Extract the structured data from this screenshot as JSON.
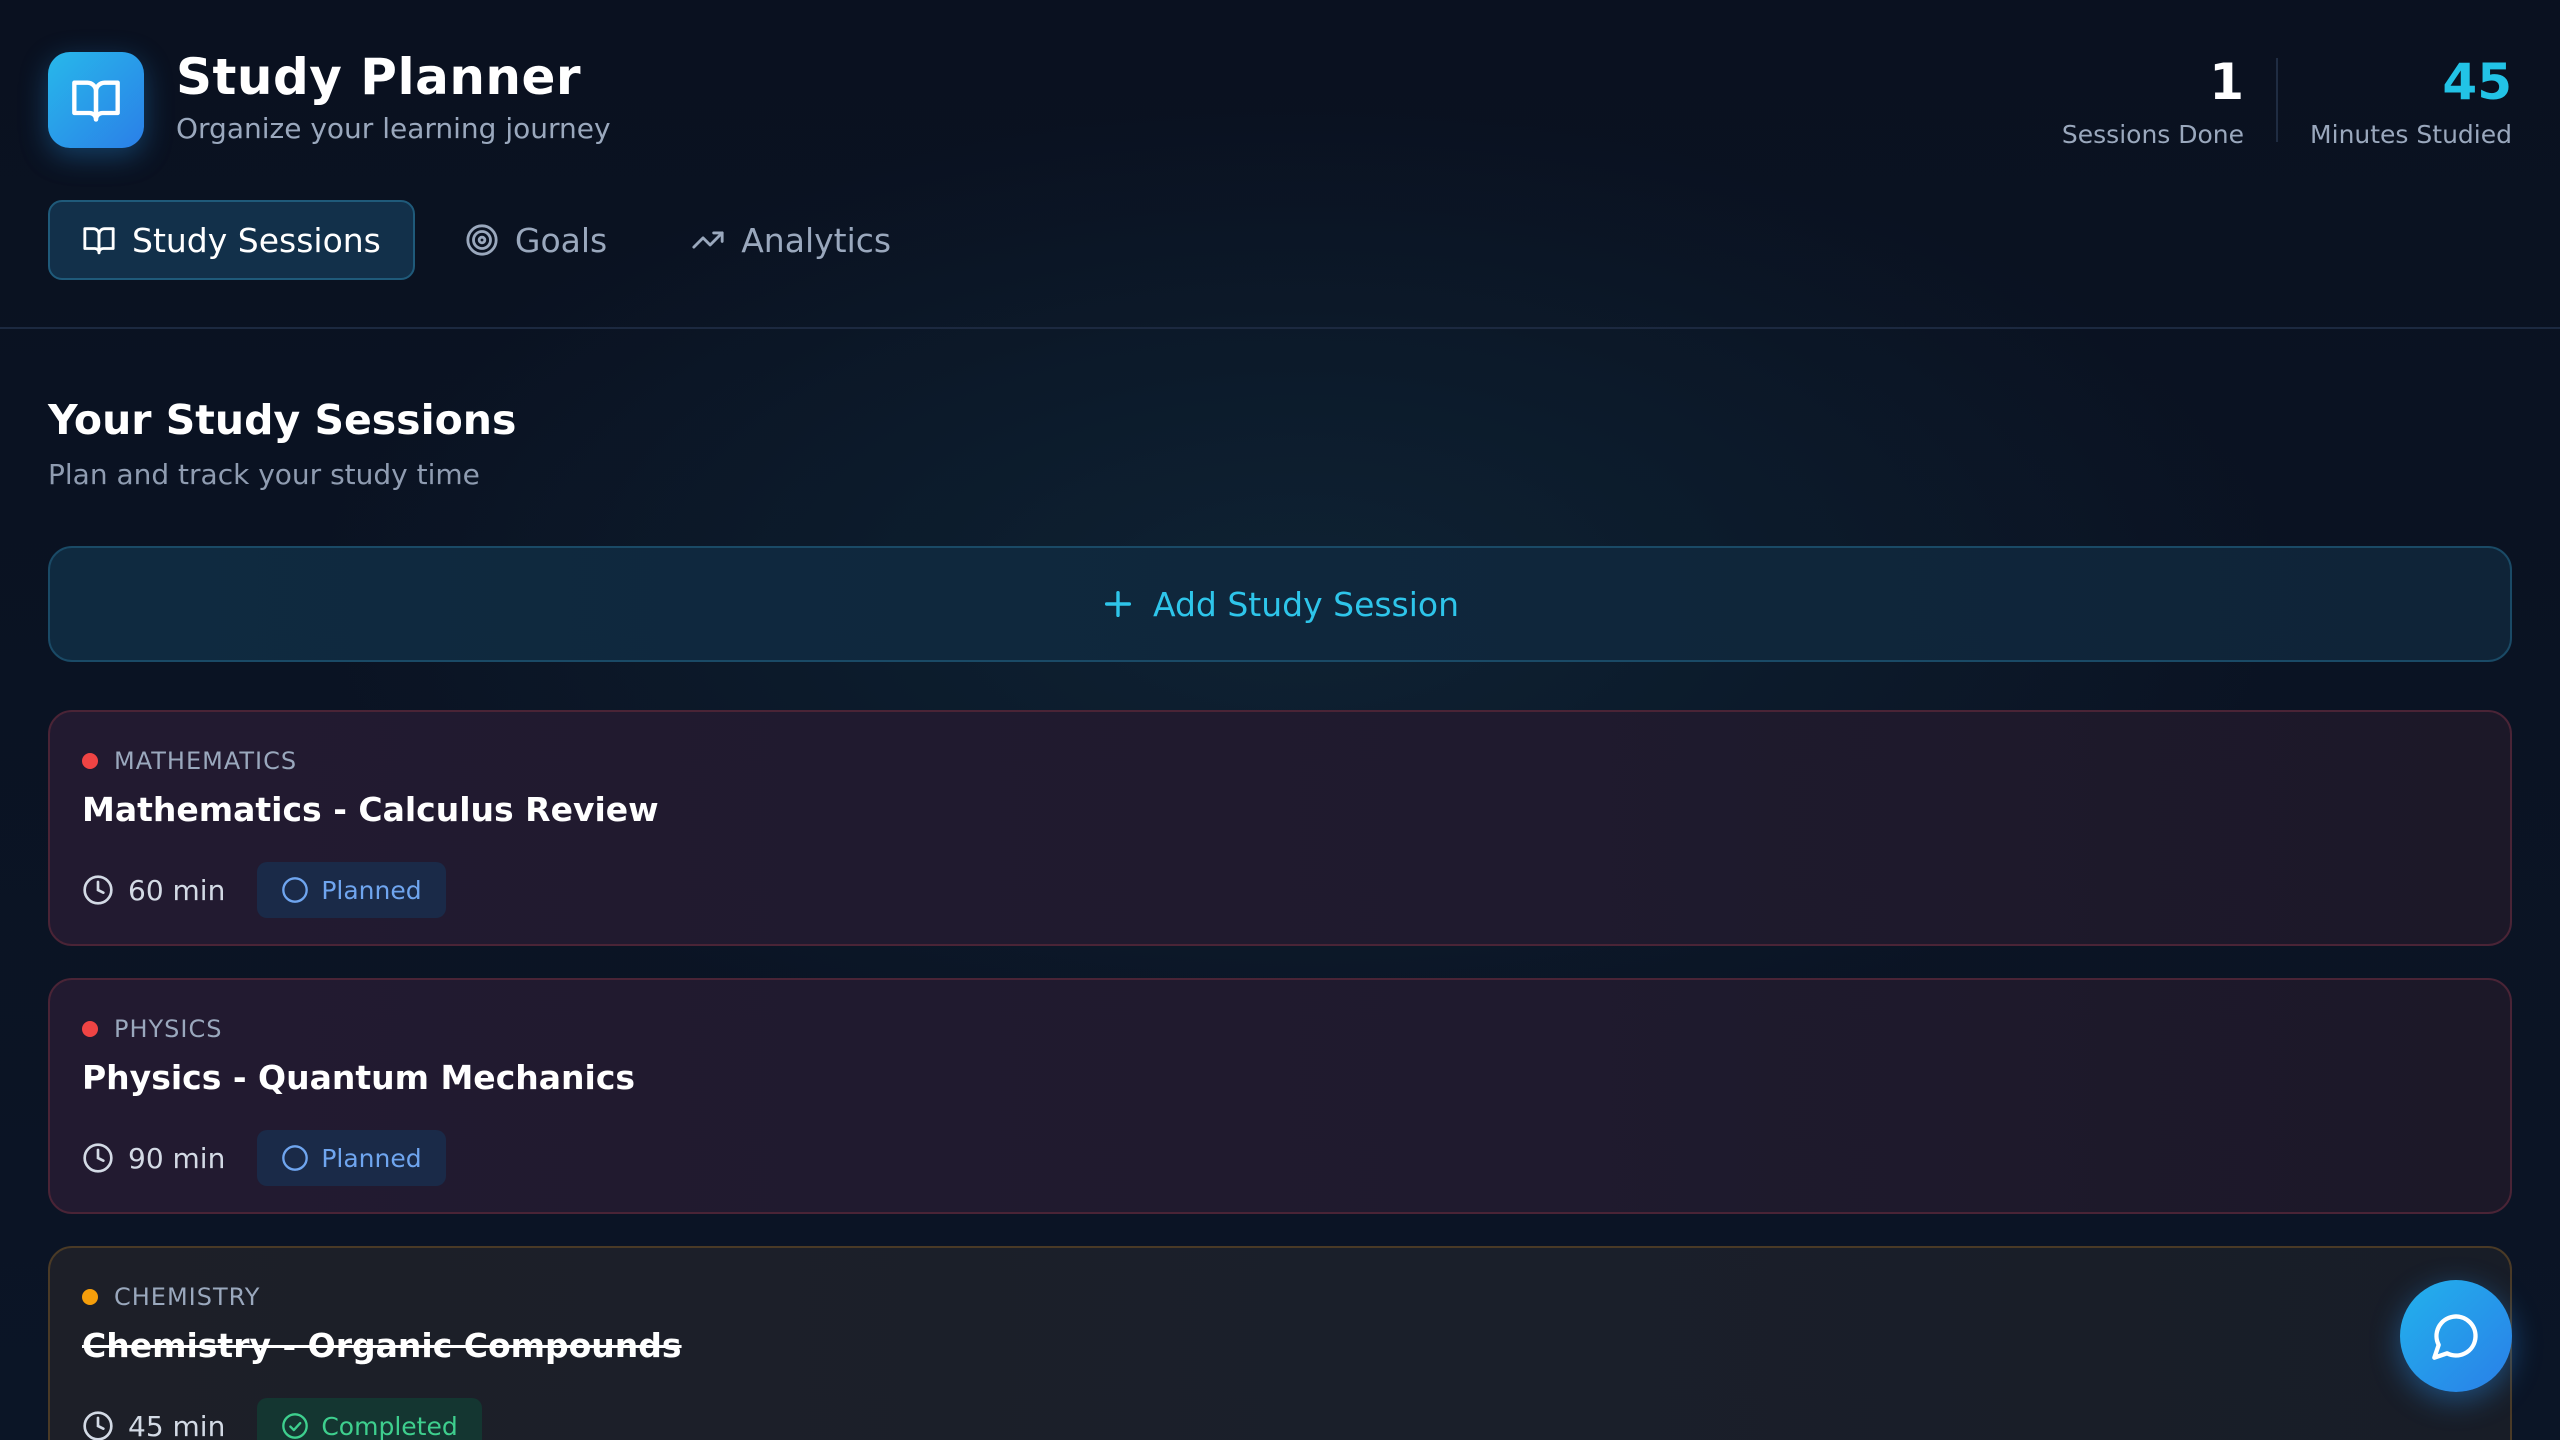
{
  "app": {
    "title": "Study Planner",
    "subtitle": "Organize your learning journey"
  },
  "stats": [
    {
      "value": "1",
      "label": "Sessions Done"
    },
    {
      "value": "45",
      "label": "Minutes Studied"
    }
  ],
  "tabs": [
    {
      "label": "Study Sessions",
      "icon": "book-open-icon",
      "active": true
    },
    {
      "label": "Goals",
      "icon": "target-icon",
      "active": false
    },
    {
      "label": "Analytics",
      "icon": "trending-up-icon",
      "active": false
    }
  ],
  "main": {
    "title": "Your Study Sessions",
    "subtitle": "Plan and track your study time",
    "add_label": "Add Study Session"
  },
  "sessions": [
    {
      "category": "MATHEMATICS",
      "title": "Mathematics - Calculus Review",
      "duration": "60 min",
      "status": "Planned",
      "dot_color": "#ef4444"
    },
    {
      "category": "PHYSICS",
      "title": "Physics - Quantum Mechanics",
      "duration": "90 min",
      "status": "Planned",
      "dot_color": "#ef4444"
    },
    {
      "category": "CHEMISTRY",
      "title": "Chemistry - Organic Compounds",
      "duration": "45 min",
      "status": "Completed",
      "dot_color": "#f59e0b"
    }
  ],
  "colors": {
    "accent": "#22c3e6",
    "planned": "#6fa5ef",
    "completed": "#3ecf8e"
  }
}
